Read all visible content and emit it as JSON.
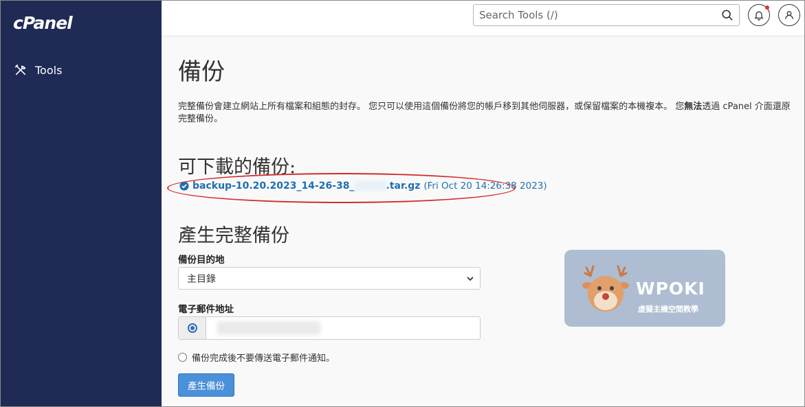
{
  "sidebar": {
    "logo": "cPanel",
    "items": [
      {
        "label": "Tools",
        "icon": "tools-icon"
      }
    ]
  },
  "header": {
    "search_placeholder": "Search Tools (/)",
    "bell_icon": "bell-icon",
    "user_icon": "user-icon"
  },
  "page": {
    "title": "備份",
    "description_part1": "完整備份會建立網站上所有檔案和組態的封存。 您只可以使用這個備份將您的帳戶移到其他伺服器，或保留檔案的本機複本。 您",
    "description_bold": "無法",
    "description_part2": "透過 cPanel 介面還原完整備份。"
  },
  "downloads": {
    "heading": "可下載的備份:",
    "backup_prefix": "backup-10.20.2023_14-26-38_",
    "backup_suffix": ".tar.gz",
    "backup_date": "(Fri Oct 20 14:26:38 2023)"
  },
  "generate": {
    "heading": "產生完整備份",
    "dest_label": "備份目的地",
    "dest_value": "主目錄",
    "email_label": "電子郵件地址",
    "notify_label": "備份完成後不要傳送電子郵件通知。",
    "button_label": "產生備份"
  },
  "watermark": {
    "title": "WPOKI",
    "subtitle": "虛擬主機空間教學"
  },
  "colors": {
    "sidebar": "#1f2a55",
    "link": "#1e6fb0",
    "button": "#4b91d9",
    "highlight": "#d62b2b"
  }
}
